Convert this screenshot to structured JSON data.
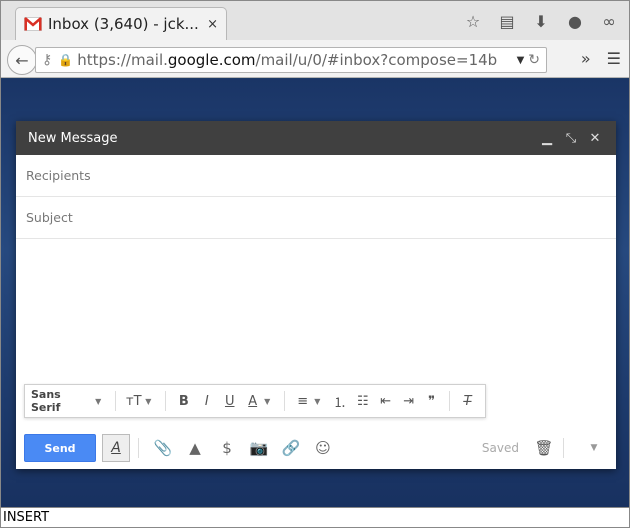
{
  "browser": {
    "tab": {
      "title": "Inbox (3,640) - jck...",
      "close": "×"
    },
    "url": {
      "prefix": "https://mail.",
      "host": "google.com",
      "suffix": "/mail/u/0/#inbox?compose=14b"
    }
  },
  "compose": {
    "title": "New Message",
    "recipients_placeholder": "Recipients",
    "subject_placeholder": "Subject",
    "font_family": "Sans Serif",
    "send_label": "Send",
    "saved_label": "Saved"
  },
  "status_bar": {
    "mode": "INSERT"
  },
  "colors": {
    "send_button": "#4a8af4",
    "compose_header": "#404040",
    "gmail_red": "#d93025"
  }
}
